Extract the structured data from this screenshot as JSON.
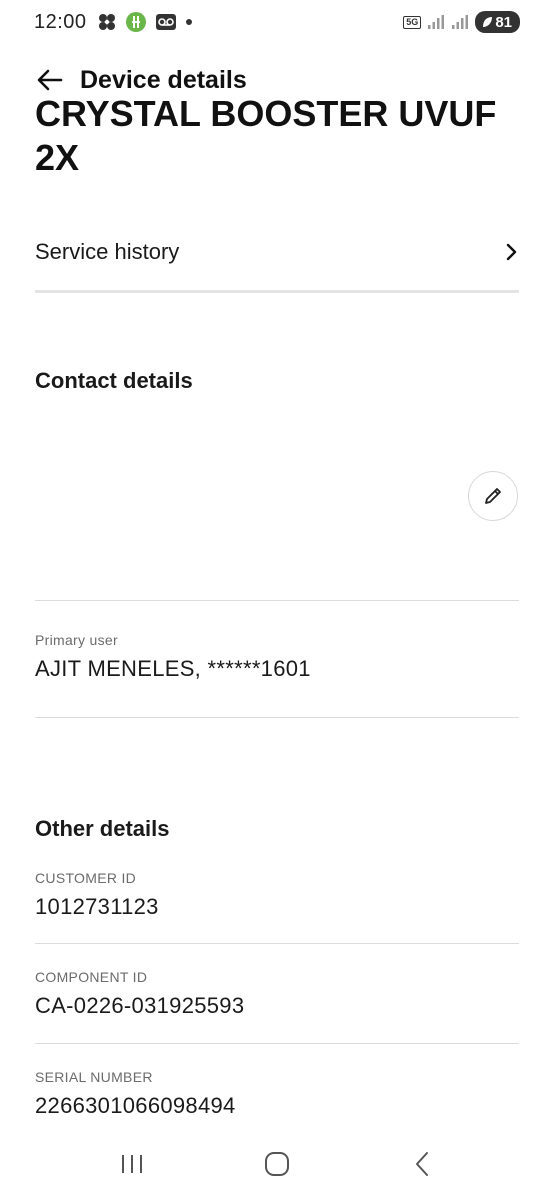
{
  "status_bar": {
    "time": "12:00",
    "network": "5G",
    "battery": "81",
    "icons": [
      "fan-icon",
      "app-notification-icon",
      "voicemail-icon",
      "dot-icon",
      "signal-icon",
      "signal-icon-2",
      "battery-icon"
    ]
  },
  "app_bar": {
    "title": "Device details",
    "back_icon": "arrow-left-icon"
  },
  "device": {
    "name": "CRYSTAL BOOSTER UVUF 2X"
  },
  "service_history": {
    "label": "Service history",
    "icon": "chevron-right-icon"
  },
  "contact_details": {
    "title": "Contact details",
    "edit_icon": "pencil-icon",
    "primary_user_label": "Primary user",
    "primary_user_value": "AJIT MENELES, ******1601"
  },
  "other_details": {
    "title": "Other details",
    "fields": [
      {
        "label": "CUSTOMER ID",
        "value": "1012731123"
      },
      {
        "label": "COMPONENT ID",
        "value": "CA-0226-031925593"
      },
      {
        "label": "SERIAL NUMBER",
        "value": "2266301066098494"
      }
    ]
  },
  "nav_bar": {
    "icons": [
      "recent-apps-icon",
      "home-icon",
      "back-nav-icon"
    ]
  },
  "colors": {
    "text": "#1a1a1a",
    "label": "#6b6b6b",
    "divider": "#dcdcdc"
  }
}
